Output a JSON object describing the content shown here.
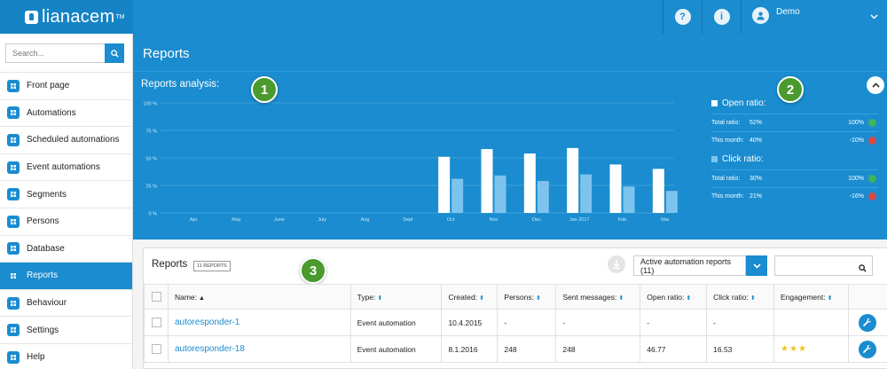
{
  "topbar": {
    "logo_text": "lianacem",
    "logo_tm": "TM",
    "help_icon": "?",
    "info_icon": "i",
    "user_name": "Demo",
    "caret": "⌄"
  },
  "sidebar": {
    "search_placeholder": "Search...",
    "items": [
      {
        "label": "Front page",
        "icon": "grid-icon"
      },
      {
        "label": "Automations",
        "icon": "hierarchy-icon"
      },
      {
        "label": "Scheduled automations",
        "icon": "calendar-icon"
      },
      {
        "label": "Event automations",
        "icon": "calendar-icon"
      },
      {
        "label": "Segments",
        "icon": "group-icon"
      },
      {
        "label": "Persons",
        "icon": "person-icon"
      },
      {
        "label": "Database",
        "icon": "database-icon"
      },
      {
        "label": "Reports",
        "icon": "chart-icon",
        "active": true
      },
      {
        "label": "Behaviour",
        "icon": "pointer-icon"
      },
      {
        "label": "Settings",
        "icon": "gears-icon"
      },
      {
        "label": "Help",
        "icon": "help-icon"
      }
    ]
  },
  "page": {
    "title": "Reports",
    "analysis_title": "Reports analysis:"
  },
  "markers": [
    "1",
    "2",
    "3"
  ],
  "chart_data": {
    "type": "bar",
    "title": "",
    "categories": [
      "Apr",
      "May",
      "June",
      "July",
      "Aug",
      "Sept",
      "Oct",
      "Nov",
      "Dec",
      "Jan 2017",
      "Feb",
      "Mar"
    ],
    "y_ticks": [
      "0 %",
      "25 %",
      "50 %",
      "75 %",
      "100 %"
    ],
    "ylim": [
      0,
      100
    ],
    "grid": true,
    "series": [
      {
        "values": [
          0,
          0,
          0,
          0,
          0,
          0,
          51,
          58,
          54,
          59,
          44,
          40
        ],
        "color": "#ffffff"
      },
      {
        "values": [
          0,
          0,
          0,
          0,
          0,
          0,
          31,
          34,
          29,
          35,
          24,
          20
        ],
        "color": "#7cc4ee"
      }
    ]
  },
  "ratios": {
    "open": {
      "title": "Open ratio:",
      "total_label": "Total ratio:",
      "total_value": "52%",
      "total_change": "100%",
      "total_trend": "up",
      "month_label": "This month:",
      "month_value": "40%",
      "month_change": "-10%",
      "month_trend": "down"
    },
    "click": {
      "title": "Click ratio:",
      "total_label": "Total ratio:",
      "total_value": "30%",
      "total_change": "100%",
      "total_trend": "up",
      "month_label": "This month:",
      "month_value": "21%",
      "month_change": "-16%",
      "month_trend": "down"
    }
  },
  "reports": {
    "title": "Reports",
    "count_badge": "11 REPORTS",
    "filter_label": "Active automation reports (11)",
    "columns": [
      "Name:",
      "Type:",
      "Created:",
      "Persons:",
      "Sent messages:",
      "Open ratio:",
      "Click ratio:",
      "Engagement:"
    ],
    "rows": [
      {
        "name": "autoresponder-1",
        "type": "Event automation",
        "created": "10.4.2015",
        "persons": "-",
        "sent": "-",
        "open": "-",
        "click": "-",
        "engagement": ""
      },
      {
        "name": "autoresponder-18",
        "type": "Event automation",
        "created": "8.1.2016",
        "persons": "248",
        "sent": "248",
        "open": "46.77",
        "click": "16.53",
        "engagement": "★★★"
      }
    ]
  },
  "colors": {
    "brand": "#1a8ccf",
    "marker": "#4a9a2e",
    "bar_open": "#ffffff",
    "bar_click": "#7cc4ee"
  }
}
